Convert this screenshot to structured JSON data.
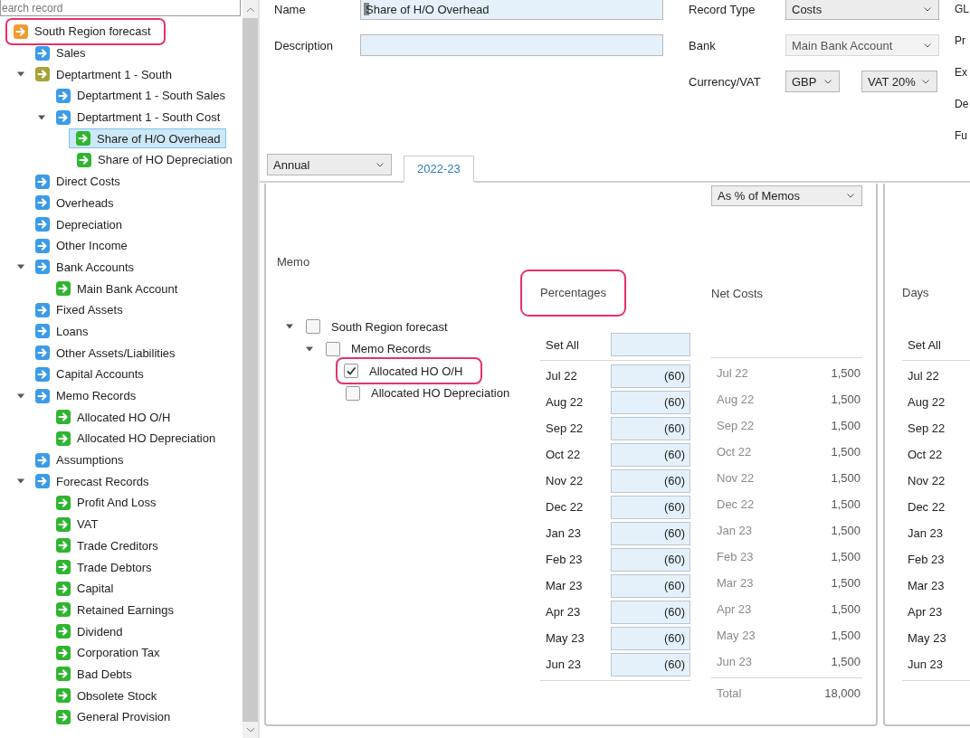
{
  "sidebar": {
    "search": {
      "placeholder": "earch record"
    },
    "tree": [
      {
        "label": "South Region forecast",
        "color": "#f39a2e",
        "highlighted": true,
        "selected": false,
        "children": [
          {
            "label": "Sales",
            "color": "#3b9be8",
            "selected": false
          },
          {
            "label": "Deptartment 1 - South",
            "color": "#a8a23a",
            "expanded": true,
            "selected": false,
            "children": [
              {
                "label": "Deptartment 1 - South Sales",
                "color": "#3b9be8",
                "selected": false
              },
              {
                "label": "Deptartment 1 - South Cost",
                "color": "#3b9be8",
                "expanded": true,
                "selected": false,
                "children": [
                  {
                    "label": "Share of H/O Overhead",
                    "color": "#2fb52f",
                    "selected": true
                  },
                  {
                    "label": "Share of  HO Depreciation",
                    "color": "#2fb52f",
                    "selected": false
                  }
                ]
              }
            ]
          },
          {
            "label": "Direct Costs",
            "color": "#3b9be8",
            "selected": false
          },
          {
            "label": "Overheads",
            "color": "#3b9be8",
            "selected": false
          },
          {
            "label": "Depreciation",
            "color": "#3b9be8",
            "selected": false
          },
          {
            "label": "Other Income",
            "color": "#3b9be8",
            "selected": false
          },
          {
            "label": "Bank Accounts",
            "color": "#3b9be8",
            "expanded": true,
            "selected": false,
            "children": [
              {
                "label": "Main Bank Account",
                "color": "#2fb52f",
                "selected": false
              }
            ]
          },
          {
            "label": "Fixed Assets",
            "color": "#3b9be8",
            "selected": false
          },
          {
            "label": "Loans",
            "color": "#3b9be8",
            "selected": false
          },
          {
            "label": "Other Assets/Liabilities",
            "color": "#3b9be8",
            "selected": false
          },
          {
            "label": "Capital Accounts",
            "color": "#3b9be8",
            "selected": false
          },
          {
            "label": "Memo Records",
            "color": "#3b9be8",
            "expanded": true,
            "selected": false,
            "children": [
              {
                "label": "Allocated HO  O/H",
                "color": "#2fb52f",
                "selected": false
              },
              {
                "label": "Allocated HO Depreciation",
                "color": "#2fb52f",
                "selected": false
              }
            ]
          },
          {
            "label": "Assumptions",
            "color": "#3b9be8",
            "selected": false
          },
          {
            "label": "Forecast Records",
            "color": "#3b9be8",
            "expanded": true,
            "selected": false,
            "children": [
              {
                "label": "Profit And Loss",
                "color": "#2fb52f",
                "selected": false
              },
              {
                "label": "VAT",
                "color": "#2fb52f",
                "selected": false
              },
              {
                "label": "Trade Creditors",
                "color": "#2fb52f",
                "selected": false
              },
              {
                "label": "Trade Debtors",
                "color": "#2fb52f",
                "selected": false
              },
              {
                "label": "Capital",
                "color": "#2fb52f",
                "selected": false
              },
              {
                "label": "Retained Earnings",
                "color": "#2fb52f",
                "selected": false
              },
              {
                "label": "Dividend",
                "color": "#2fb52f",
                "selected": false
              },
              {
                "label": "Corporation Tax",
                "color": "#2fb52f",
                "selected": false
              },
              {
                "label": "Bad Debts",
                "color": "#2fb52f",
                "selected": false
              },
              {
                "label": "Obsolete Stock",
                "color": "#2fb52f",
                "selected": false
              },
              {
                "label": "General Provision",
                "color": "#2fb52f",
                "selected": false
              }
            ]
          }
        ]
      }
    ]
  },
  "form": {
    "name": {
      "label": "Name",
      "value": "Share of H/O Overhead"
    },
    "description": {
      "label": "Description"
    },
    "record_type": {
      "label": "Record Type",
      "value": "Costs",
      "disabled": false
    },
    "bank": {
      "label": "Bank",
      "value": "Main Bank Account",
      "disabled": true
    },
    "currency_vat": {
      "label": "Currency/VAT",
      "currency": "GBP",
      "vat": "VAT 20%"
    },
    "cut_labels": [
      "GL",
      "Pr",
      "Ex",
      "De",
      "Fu"
    ]
  },
  "period_select": "Annual",
  "tabs": [
    {
      "label": "2022-23",
      "selected": true
    }
  ],
  "allocation": {
    "mode_select": "As % of Memos",
    "memo_label": "Memo",
    "memo_tree": [
      {
        "label": "South Region forecast",
        "checked": false,
        "expanded": true,
        "highlighted": false,
        "children": [
          {
            "label": "Memo Records",
            "checked": false,
            "expanded": true,
            "highlighted": false,
            "children": [
              {
                "label": "Allocated HO  O/H",
                "checked": true,
                "highlighted": true
              },
              {
                "label": "Allocated HO Depreciation",
                "checked": false,
                "highlighted": false
              }
            ]
          }
        ]
      }
    ],
    "percentages": {
      "header": "Percentages",
      "highlighted": true,
      "set_all_label": "Set All",
      "rows": [
        {
          "month": "Jul 22",
          "value": "(60)"
        },
        {
          "month": "Aug 22",
          "value": "(60)"
        },
        {
          "month": "Sep 22",
          "value": "(60)"
        },
        {
          "month": "Oct 22",
          "value": "(60)"
        },
        {
          "month": "Nov 22",
          "value": "(60)"
        },
        {
          "month": "Dec 22",
          "value": "(60)"
        },
        {
          "month": "Jan 23",
          "value": "(60)"
        },
        {
          "month": "Feb 23",
          "value": "(60)"
        },
        {
          "month": "Mar 23",
          "value": "(60)"
        },
        {
          "month": "Apr 23",
          "value": "(60)"
        },
        {
          "month": "May 23",
          "value": "(60)"
        },
        {
          "month": "Jun 23",
          "value": "(60)"
        }
      ]
    },
    "net_costs": {
      "header": "Net Costs",
      "rows": [
        {
          "month": "Jul 22",
          "value": "1,500"
        },
        {
          "month": "Aug 22",
          "value": "1,500"
        },
        {
          "month": "Sep 22",
          "value": "1,500"
        },
        {
          "month": "Oct 22",
          "value": "1,500"
        },
        {
          "month": "Nov 22",
          "value": "1,500"
        },
        {
          "month": "Dec 22",
          "value": "1,500"
        },
        {
          "month": "Jan 23",
          "value": "1,500"
        },
        {
          "month": "Feb 23",
          "value": "1,500"
        },
        {
          "month": "Mar 23",
          "value": "1,500"
        },
        {
          "month": "Apr 23",
          "value": "1,500"
        },
        {
          "month": "May 23",
          "value": "1,500"
        },
        {
          "month": "Jun 23",
          "value": "1,500"
        }
      ],
      "total_label": "Total",
      "total": "18,000"
    }
  },
  "days_panel": {
    "header": "Days",
    "set_all_label": "Set All",
    "months": [
      "Jul 22",
      "Aug 22",
      "Sep 22",
      "Oct 22",
      "Nov 22",
      "Dec 22",
      "Jan 23",
      "Feb 23",
      "Mar 23",
      "Apr 23",
      "May 23",
      "Jun 23"
    ]
  }
}
